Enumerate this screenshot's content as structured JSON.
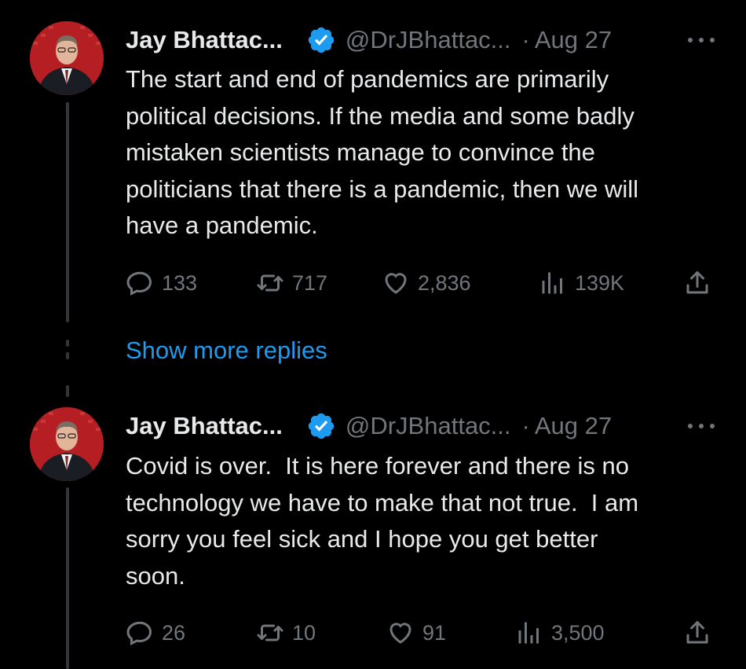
{
  "tweets": [
    {
      "author_name": "Jay Bhattac...",
      "handle": "@DrJBhattac...",
      "separator": "·",
      "date": "Aug 27",
      "text": "The start and end of pandemics are primarily\npolitical decisions. If the media and some badly\nmistaken scientists manage to convince the\npoliticians that there is a pandemic, then we will\nhave a pandemic.",
      "replies": "133",
      "retweets": "717",
      "likes": "2,836",
      "views": "139K"
    },
    {
      "author_name": "Jay Bhattac...",
      "handle": "@DrJBhattac...",
      "separator": "·",
      "date": "Aug 27",
      "text": "Covid is over.  It is here forever and there is no\ntechnology we have to make that not true.  I am\nsorry you feel sick and I hope you get better\nsoon.",
      "replies": "26",
      "retweets": "10",
      "likes": "91",
      "views": "3,500"
    }
  ],
  "show_more_replies": "Show more replies",
  "icons": {
    "verified": "verified-badge-icon",
    "more": "more-options-icon",
    "reply": "reply-icon",
    "retweet": "retweet-icon",
    "like": "like-heart-icon",
    "views": "views-bar-chart-icon",
    "share": "share-icon"
  },
  "colors": {
    "background": "#000000",
    "text": "#e7e9ea",
    "muted": "#71767b",
    "link": "#1d9bf0",
    "verified": "#1d9bf0"
  }
}
